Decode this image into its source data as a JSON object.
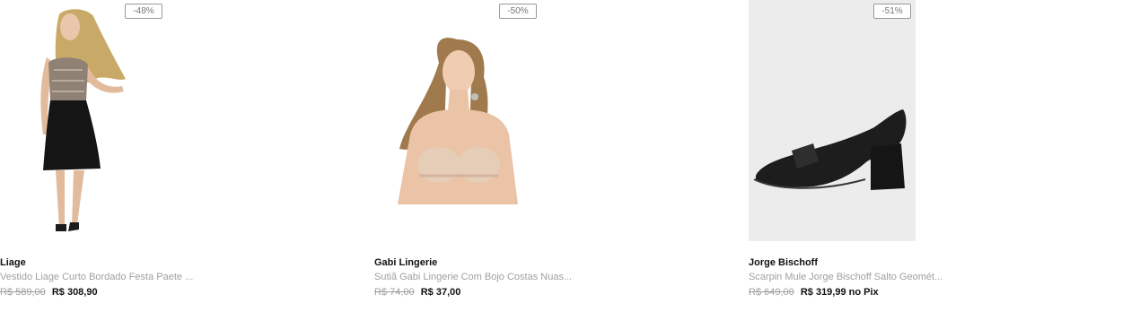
{
  "products": [
    {
      "discount": "-48%",
      "brand": "Liage",
      "description": "Vestido Liage Curto Bordado Festa Paete ...",
      "old_price": "R$ 589,00",
      "new_price": "R$ 308,90",
      "pix_label": ""
    },
    {
      "discount": "-50%",
      "brand": "Gabi Lingerie",
      "description": "Sutiã Gabi Lingerie Com Bojo Costas Nuas...",
      "old_price": "R$ 74,00",
      "new_price": "R$ 37,00",
      "pix_label": ""
    },
    {
      "discount": "-51%",
      "brand": "Jorge Bischoff",
      "description": "Scarpin Mule Jorge Bischoff Salto Geomét...",
      "old_price": "R$ 649,00",
      "new_price": "R$ 319,99",
      "pix_label": "no Pix"
    }
  ],
  "colors": {
    "muted_text": "#a0a0a0",
    "strong_text": "#111111",
    "shoe_background": "#ececec"
  }
}
